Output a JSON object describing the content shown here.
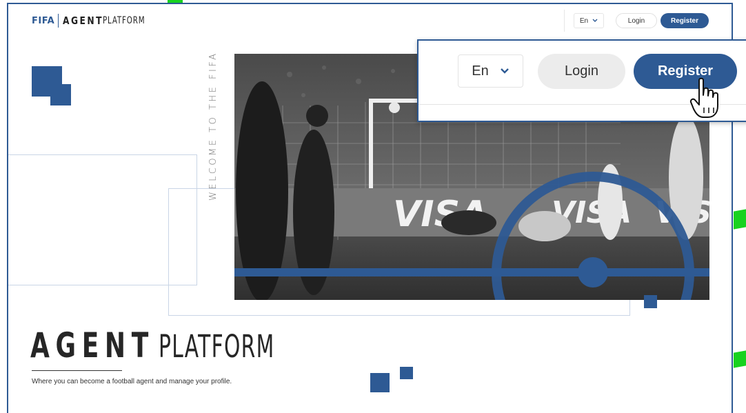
{
  "header": {
    "brand_fifa": "FIFA",
    "brand_agent": "AGENT",
    "brand_platform": "PLATFORM",
    "language": "En",
    "login_label": "Login",
    "register_label": "Register"
  },
  "hero": {
    "vertical_text": "WELCOME TO THE FIFA",
    "banner_text": "VISA"
  },
  "main": {
    "title_bold": "AGENT",
    "title_light": "PLATFORM",
    "subtitle": "Where you can become a football agent and manage your profile."
  },
  "callout": {
    "language": "En",
    "login_label": "Login",
    "register_label": "Register"
  },
  "colors": {
    "brand_blue": "#2e5a94",
    "highlight_green": "#18d21f",
    "login_bg": "#ececec"
  },
  "icons": [
    "chevron-down-icon",
    "hand-pointer-icon"
  ]
}
